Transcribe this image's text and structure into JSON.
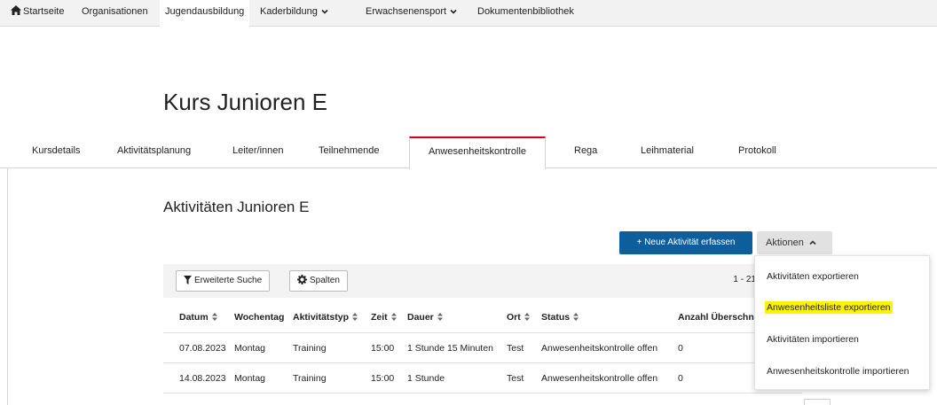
{
  "nav": {
    "items": [
      {
        "label": "Startseite",
        "icon": "home-icon"
      },
      {
        "label": "Organisationen"
      },
      {
        "label": "Jugendausbildung",
        "active": true
      },
      {
        "label": "Kaderbildung",
        "has_dropdown": true
      },
      {
        "label": "Erwachsenensport",
        "has_dropdown": true
      },
      {
        "label": "Dokumentenbibliothek"
      }
    ]
  },
  "page": {
    "title": "Kurs Junioren E"
  },
  "tabs": [
    {
      "label": "Kursdetails"
    },
    {
      "label": "Aktivitätsplanung"
    },
    {
      "label": "Leiter/innen"
    },
    {
      "label": "Teilnehmende"
    },
    {
      "label": "Anwesenheitskontrolle",
      "active": true
    },
    {
      "label": "Rega"
    },
    {
      "label": "Leihmaterial"
    },
    {
      "label": "Protokoll"
    }
  ],
  "section": {
    "title": "Aktivitäten Junioren E"
  },
  "actions": {
    "new_activity": "+ Neue Aktivität erfassen",
    "actions_label": "Aktionen"
  },
  "toolbar": {
    "advanced_search": "Erweiterte Suche",
    "columns": "Spalten",
    "pager": "1 - 21"
  },
  "table": {
    "headers": [
      "Datum",
      "Wochentag",
      "Aktivitätstyp",
      "Zeit",
      "Dauer",
      "Ort",
      "Status",
      "Anzahl Überschne"
    ],
    "rows": [
      [
        "07.08.2023",
        "Montag",
        "Training",
        "15:00",
        "1 Stunde 15 Minuten",
        "Test",
        "Anwesenheitskontrolle offen",
        "0"
      ],
      [
        "14.08.2023",
        "Montag",
        "Training",
        "15:00",
        "1 Stunde",
        "Test",
        "Anwesenheitskontrolle offen",
        "0"
      ]
    ]
  },
  "dropdown": {
    "items": [
      {
        "label": "Aktivitäten exportieren"
      },
      {
        "label": "Anwesenheitsliste exportieren",
        "highlighted": true
      },
      {
        "label": "Aktivitäten importieren"
      },
      {
        "label": "Anwesenheitskontrolle importieren"
      }
    ]
  },
  "colors": {
    "primary": "#0d5e9c",
    "active_tab_accent": "#d0021b",
    "highlight": "#fff200"
  }
}
